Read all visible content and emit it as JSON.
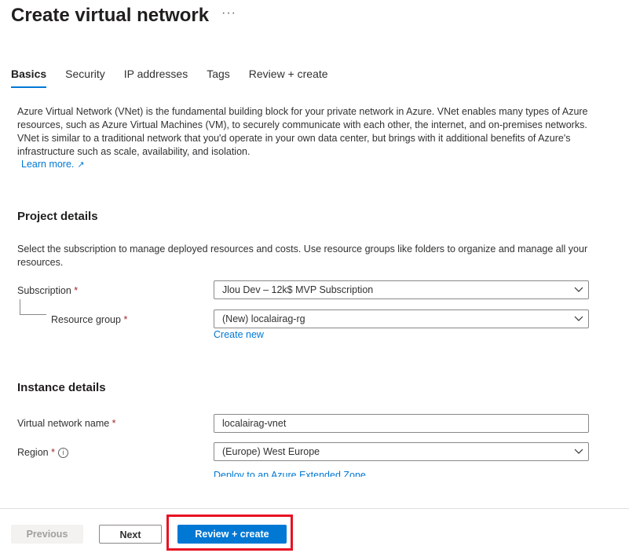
{
  "header": {
    "title": "Create virtual network",
    "more_label": "···"
  },
  "tabs": [
    {
      "label": "Basics",
      "active": true
    },
    {
      "label": "Security",
      "active": false
    },
    {
      "label": "IP addresses",
      "active": false
    },
    {
      "label": "Tags",
      "active": false
    },
    {
      "label": "Review + create",
      "active": false
    }
  ],
  "intro": {
    "text": "Azure Virtual Network (VNet) is the fundamental building block for your private network in Azure. VNet enables many types of Azure resources, such as Azure Virtual Machines (VM), to securely communicate with each other, the internet, and on-premises networks. VNet is similar to a traditional network that you'd operate in your own data center, but brings with it additional benefits of Azure's infrastructure such as scale, availability, and isolation.",
    "learn_more": "Learn more."
  },
  "project": {
    "heading": "Project details",
    "description": "Select the subscription to manage deployed resources and costs. Use resource groups like folders to organize and manage all your resources.",
    "subscription_label": "Subscription",
    "subscription_value": "Jlou Dev – 12k$ MVP Subscription",
    "resource_group_label": "Resource group",
    "resource_group_value": "(New) localairag-rg",
    "create_new": "Create new"
  },
  "instance": {
    "heading": "Instance details",
    "vnet_name_label": "Virtual network name",
    "vnet_name_value": "localairag-vnet",
    "region_label": "Region",
    "region_value": "(Europe) West Europe",
    "extended_zone_link": "Deploy to an Azure Extended Zone"
  },
  "required_marker": "*",
  "footer": {
    "previous": "Previous",
    "next": "Next",
    "review_create": "Review + create"
  },
  "colors": {
    "accent": "#0078d4",
    "highlight": "#e81123",
    "required": "#a4262c"
  }
}
